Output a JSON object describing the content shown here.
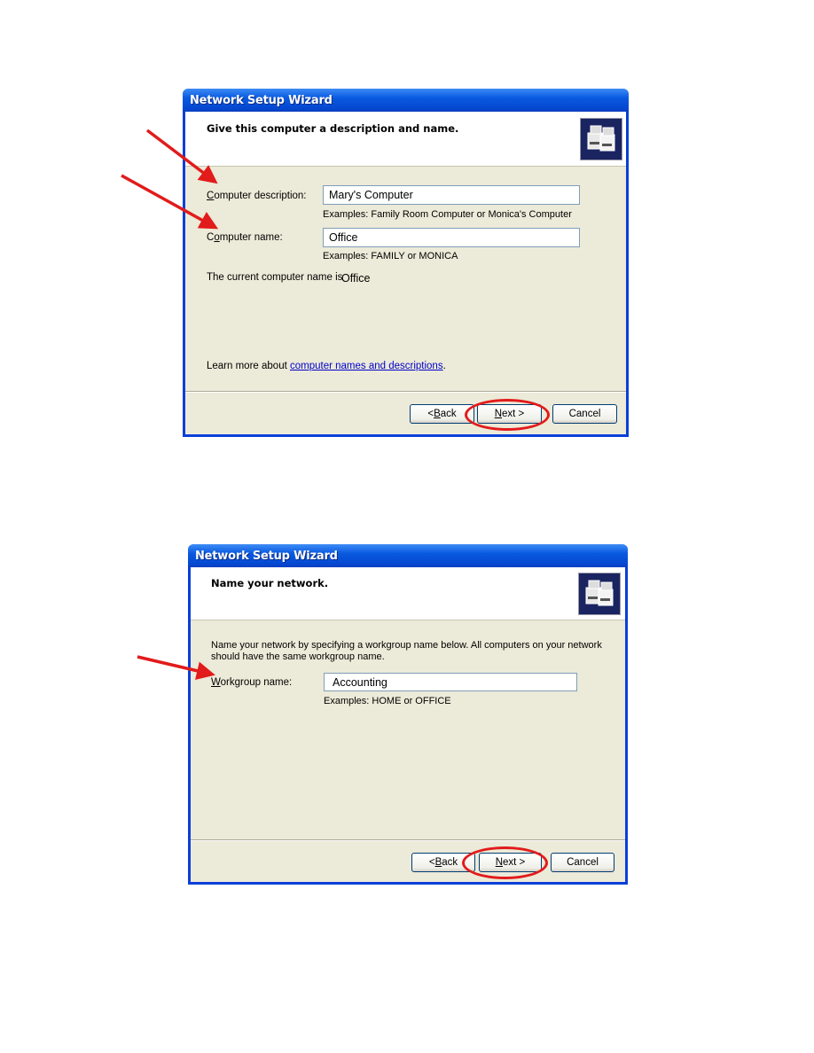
{
  "dialogs": [
    {
      "window_title": "Network Setup Wizard",
      "header_title": "Give this computer a description and name.",
      "header_icon": "network-computers-icon",
      "fields": [
        {
          "label_prefix": "",
          "label_accel": "C",
          "label_rest": "omputer description:",
          "value": "Mary's Computer",
          "hint": "Examples: Family Room Computer or Monica's Computer"
        },
        {
          "label_prefix": "C",
          "label_accel": "o",
          "label_rest": "mputer name:",
          "value": "Office",
          "hint": "Examples: FAMILY or MONICA"
        }
      ],
      "current_name_label": "The current computer name is",
      "current_name_value": "Office",
      "learn_more_prefix": "Learn more about ",
      "learn_more_link": "computer names and descriptions",
      "learn_more_suffix": ".",
      "buttons": {
        "back": {
          "prefix": "< ",
          "accel": "B",
          "rest": "ack"
        },
        "next": {
          "prefix": "",
          "accel": "N",
          "rest": "ext >"
        },
        "cancel": "Cancel"
      }
    },
    {
      "window_title": "Network Setup Wizard",
      "header_title": "Name your network.",
      "header_icon": "network-computers-icon",
      "intro_line1": "Name your network by specifying a workgroup name below. All computers on your network",
      "intro_line2": "should have the same workgroup name.",
      "fields": [
        {
          "label_prefix": "",
          "label_accel": "W",
          "label_rest": "orkgroup name:",
          "value": "Accounting",
          "hint": "Examples: HOME or OFFICE"
        }
      ],
      "buttons": {
        "back": {
          "prefix": "< ",
          "accel": "B",
          "rest": "ack"
        },
        "next": {
          "prefix": "",
          "accel": "N",
          "rest": "ext >"
        },
        "cancel": "Cancel"
      }
    }
  ],
  "annotation_color": "#e21b1b"
}
